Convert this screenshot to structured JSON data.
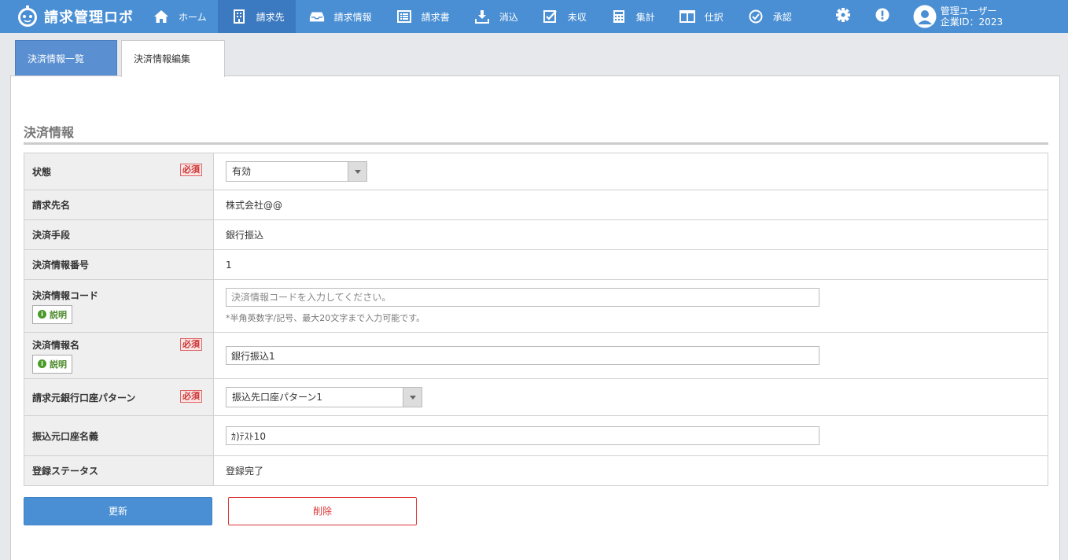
{
  "app": {
    "title": "請求管理ロボ"
  },
  "nav": {
    "items": [
      {
        "label": "ホーム",
        "icon": "home-icon"
      },
      {
        "label": "請求先",
        "icon": "building-icon"
      },
      {
        "label": "請求情報",
        "icon": "inbox-icon"
      },
      {
        "label": "請求書",
        "icon": "list-icon"
      },
      {
        "label": "消込",
        "icon": "download-icon"
      },
      {
        "label": "未収",
        "icon": "checkbox-icon"
      },
      {
        "label": "集計",
        "icon": "calculator-icon"
      },
      {
        "label": "仕訳",
        "icon": "columns-icon"
      },
      {
        "label": "承認",
        "icon": "check-circle-icon"
      }
    ],
    "active_index": 1
  },
  "user": {
    "name": "管理ユーザー",
    "company": "企業ID：2023"
  },
  "tabs": {
    "list": "決済情報一覧",
    "edit": "決済情報編集"
  },
  "section": {
    "title": "決済情報"
  },
  "form": {
    "required_badge": "必須",
    "explain_label": "説明",
    "rows": {
      "status": {
        "label": "状態",
        "value": "有効"
      },
      "billing_name": {
        "label": "請求先名",
        "value": "株式会社@@"
      },
      "payment_method": {
        "label": "決済手段",
        "value": "銀行振込"
      },
      "payment_number": {
        "label": "決済情報番号",
        "value": "1"
      },
      "payment_code": {
        "label": "決済情報コード",
        "value": "",
        "placeholder": "決済情報コードを入力してください。",
        "hint": "*半角英数字/記号、最大20文字まで入力可能です。"
      },
      "payment_name": {
        "label": "決済情報名",
        "value": "銀行振込1"
      },
      "bank_pattern": {
        "label": "請求元銀行口座パターン",
        "value": "振込先口座パターン1"
      },
      "account_name": {
        "label": "振込元口座名義",
        "value": "ｶ)ﾃｽﾄ10"
      },
      "reg_status": {
        "label": "登録ステータス",
        "value": "登録完了"
      }
    }
  },
  "buttons": {
    "update": "更新",
    "delete": "削除"
  },
  "colors": {
    "nav": "#4a8fd4",
    "nav_active": "#3b7ac0",
    "required": "#cc3333",
    "explain": "#4a9a2a"
  }
}
